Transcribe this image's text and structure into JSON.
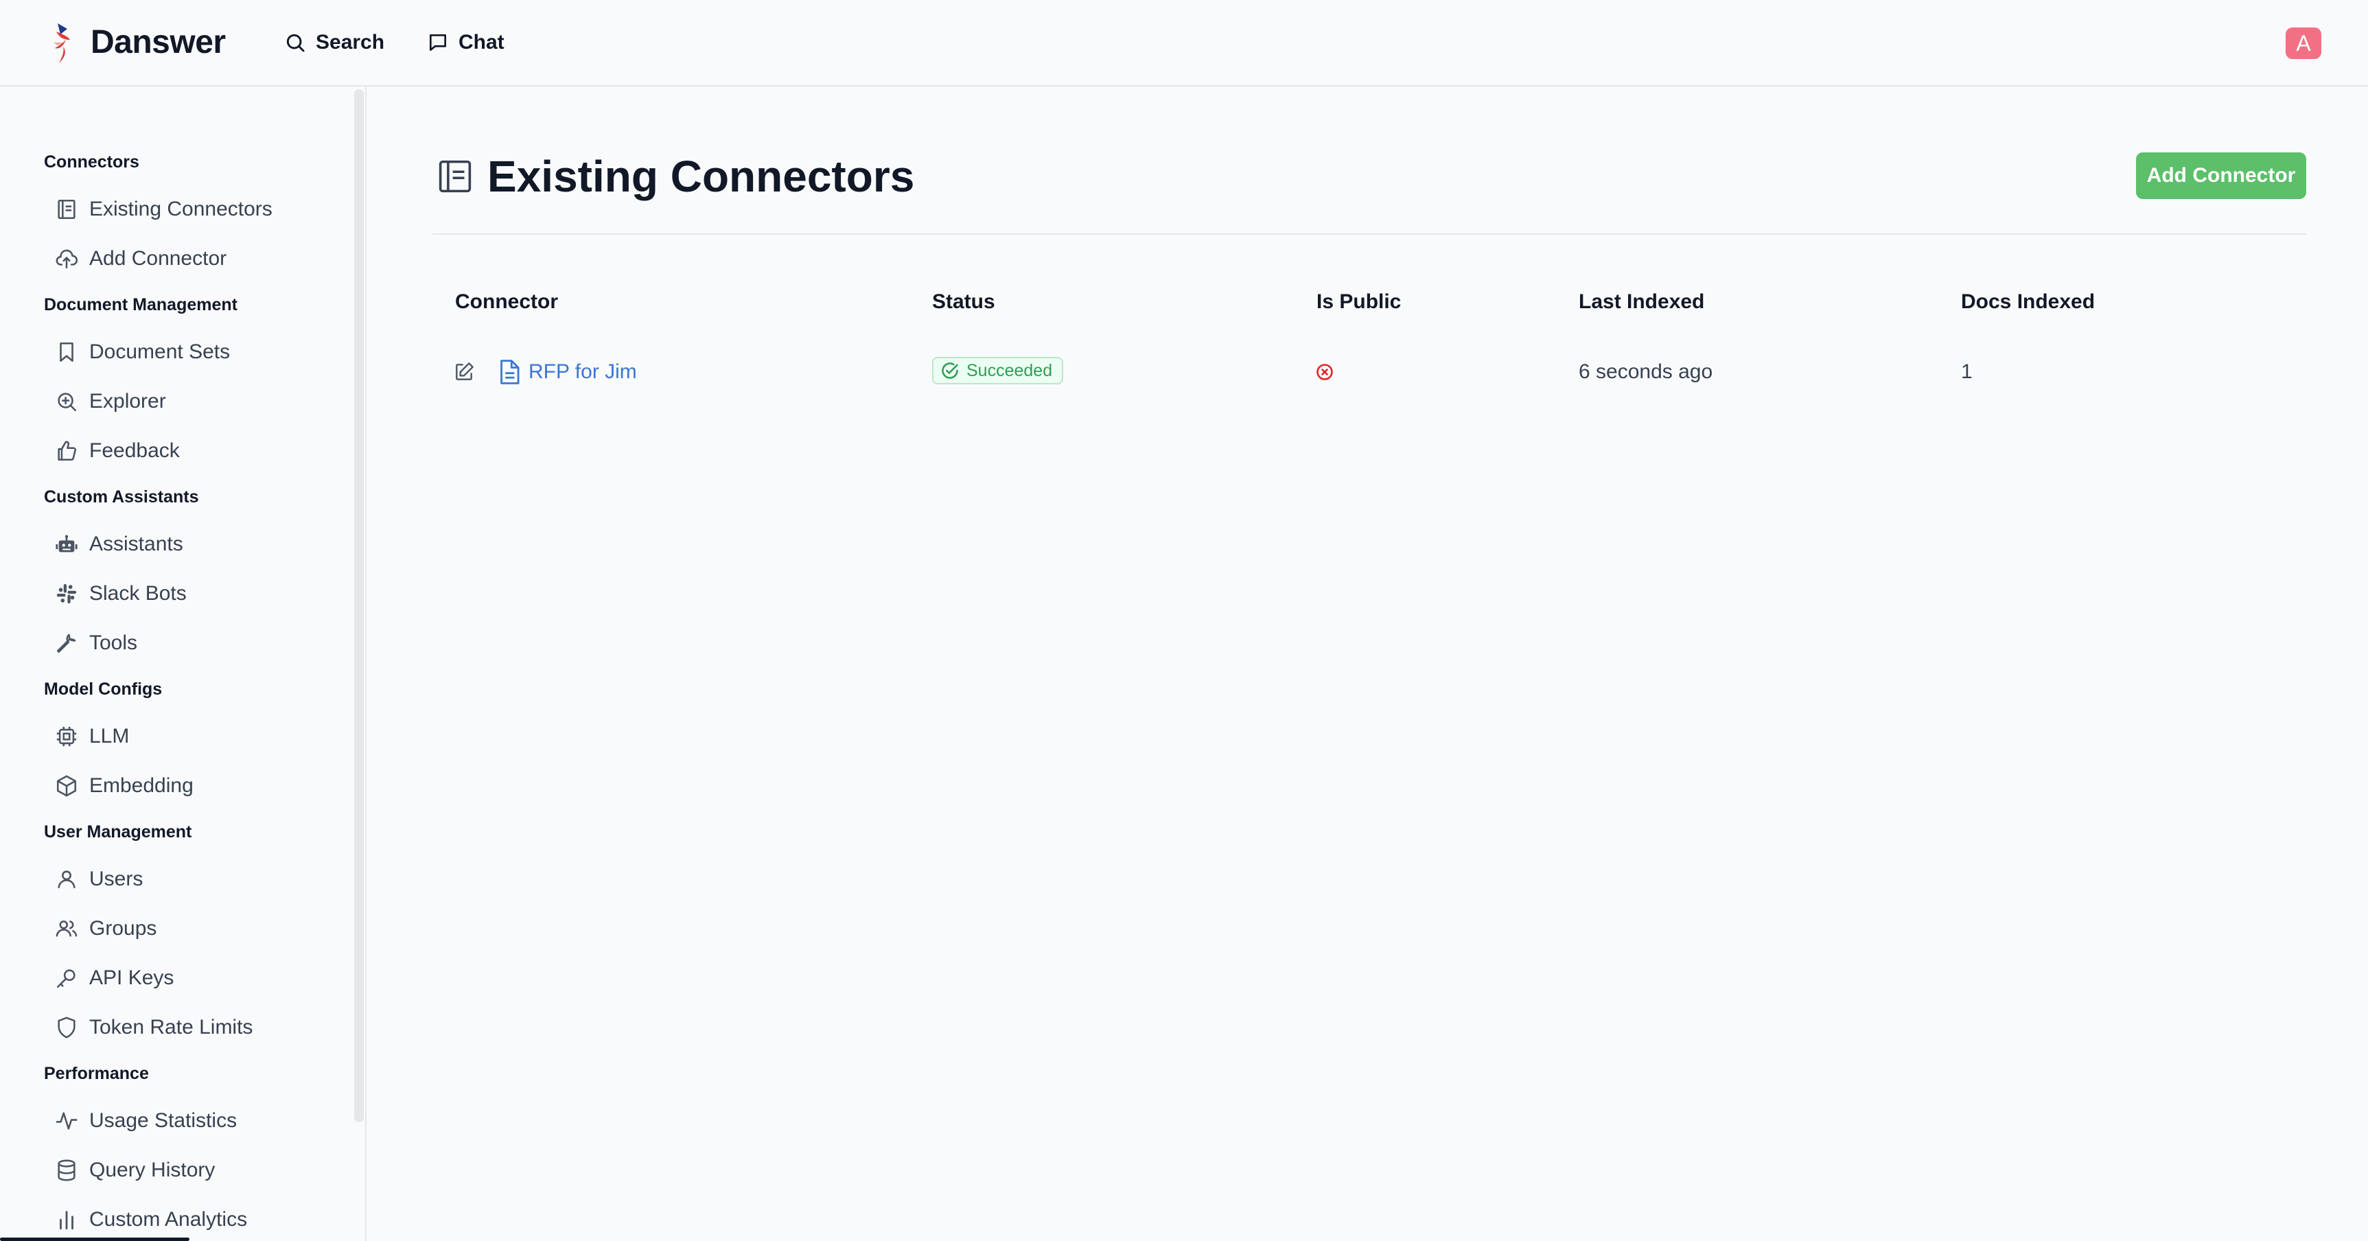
{
  "app": {
    "brand": "Danswer",
    "nav": {
      "search": "Search",
      "chat": "Chat"
    },
    "avatar_initial": "A",
    "avatar_color": "#f27084"
  },
  "sidebar": {
    "sections": [
      {
        "title": "Connectors",
        "items": [
          {
            "label": "Existing Connectors",
            "icon": "list-doc-icon"
          },
          {
            "label": "Add Connector",
            "icon": "cloud-upload-icon"
          }
        ]
      },
      {
        "title": "Document Management",
        "items": [
          {
            "label": "Document Sets",
            "icon": "bookmark-icon"
          },
          {
            "label": "Explorer",
            "icon": "zoom-in-icon"
          },
          {
            "label": "Feedback",
            "icon": "thumbs-up-icon"
          }
        ]
      },
      {
        "title": "Custom Assistants",
        "items": [
          {
            "label": "Assistants",
            "icon": "robot-icon"
          },
          {
            "label": "Slack Bots",
            "icon": "slack-icon"
          },
          {
            "label": "Tools",
            "icon": "wrench-icon"
          }
        ]
      },
      {
        "title": "Model Configs",
        "items": [
          {
            "label": "LLM",
            "icon": "cpu-icon"
          },
          {
            "label": "Embedding",
            "icon": "cube-icon"
          }
        ]
      },
      {
        "title": "User Management",
        "items": [
          {
            "label": "Users",
            "icon": "user-icon"
          },
          {
            "label": "Groups",
            "icon": "users-icon"
          },
          {
            "label": "API Keys",
            "icon": "key-icon"
          },
          {
            "label": "Token Rate Limits",
            "icon": "shield-icon"
          }
        ]
      },
      {
        "title": "Performance",
        "items": [
          {
            "label": "Usage Statistics",
            "icon": "activity-icon"
          },
          {
            "label": "Query History",
            "icon": "database-icon"
          },
          {
            "label": "Custom Analytics",
            "icon": "bar-chart-icon"
          }
        ]
      }
    ]
  },
  "main": {
    "title": "Existing Connectors",
    "add_button": "Add Connector",
    "accent_color": "#5cbf6a",
    "table": {
      "headers": [
        "Connector",
        "Status",
        "Is Public",
        "Last Indexed",
        "Docs Indexed"
      ],
      "rows": [
        {
          "connector": "RFP for Jim",
          "status": "Succeeded",
          "is_public": false,
          "last_indexed": "6 seconds ago",
          "docs_indexed": "1"
        }
      ]
    }
  }
}
